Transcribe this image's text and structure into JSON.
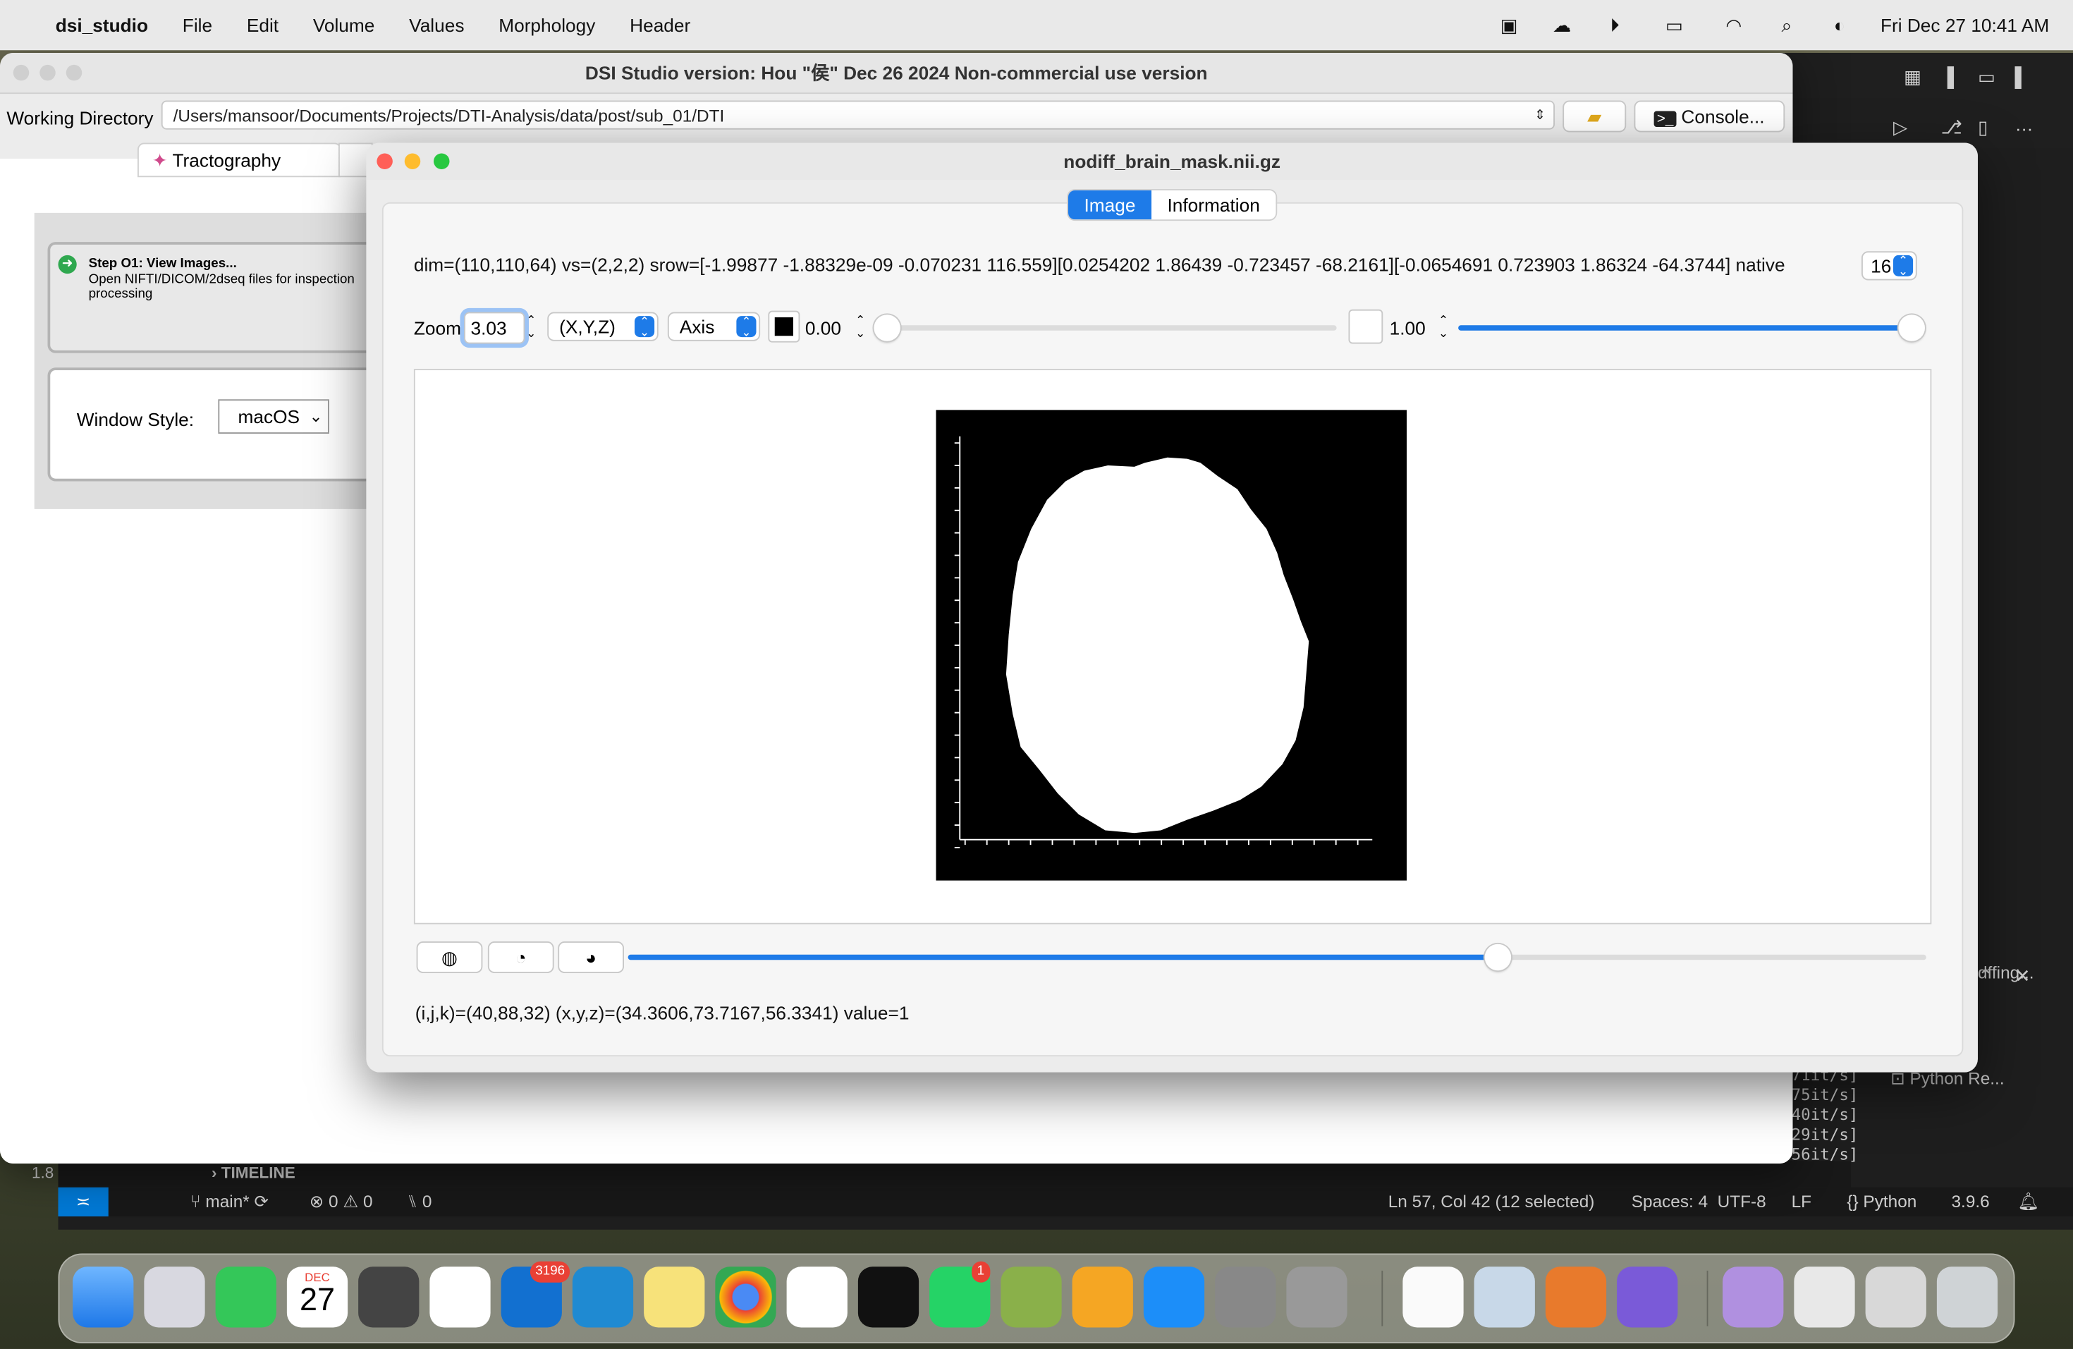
{
  "menubar": {
    "app": "dsi_studio",
    "items": [
      "File",
      "Edit",
      "Volume",
      "Values",
      "Morphology",
      "Header"
    ],
    "datetime": "Fri Dec 27  10:41 AM"
  },
  "main_window": {
    "title": "DSI Studio version: Hou \"侯\" Dec 26 2024 Non-commercial use version",
    "working_dir_label": "Working Directory",
    "working_dir": "/Users/mansoor/Documents/Projects/DTI-Analysis/data/post/sub_01/DTI",
    "console_label": "Console...",
    "tab_tractography": "Tractography",
    "step_title": "Step O1: View Images...",
    "step_desc": "Open NIFTI/DICOM/2dseq files for inspection processing",
    "window_style_label": "Window Style:",
    "window_style_value": "macOS"
  },
  "viewer": {
    "title": "nodiff_brain_mask.nii.gz",
    "tabs": [
      "Image",
      "Information"
    ],
    "active_tab": "Image",
    "info_line": "dim=(110,110,64) vs=(2,2,2) srow=[-1.99877 -1.88329e-09 -0.070231 116.559][0.0254202 1.86439 -0.723457 -68.2161][-0.0654691 0.723903 1.86324 -64.3744] native",
    "native_value": "16",
    "zoom_label": "Zoom",
    "zoom_value": "3.03",
    "coord_mode": "(X,Y,Z)",
    "axis_mode": "Axis",
    "min_value": "0.00",
    "max_value": "1.00",
    "slice_fraction": 0.67,
    "min_fraction": 0.0,
    "max_fraction": 1.0,
    "status": "(i,j,k)=(40,88,32) (x,y,z)=(34.3606,73.7167,56.3341) value=1"
  },
  "vscode": {
    "timeline": "TIMELINE",
    "branch": "main*",
    "problems": "0",
    "warnings": "0",
    "ports": "0",
    "cursor": "Ln 57, Col 42 (12 selected)",
    "spaces": "Spaces: 4",
    "encoding": "UTF-8",
    "eol": "LF",
    "language": "Python",
    "python_version": "3.9.6",
    "terminal_tab": "Python Re...",
    "terminal_lines": [
      "71it/s]",
      "75it/s]",
      "40it/s]",
      "29it/s]",
      "56it/s]"
    ],
    "panel_text": "dffing...",
    "left_num": "1.8"
  },
  "dock": {
    "calendar_month": "DEC",
    "calendar_day": "27",
    "outlook_badge": "3196",
    "whatsapp_badge": "1"
  },
  "colors": {
    "accent": "#1e7be8",
    "close": "#ff5f57",
    "minimize": "#febc2e",
    "zoom": "#28c840"
  }
}
